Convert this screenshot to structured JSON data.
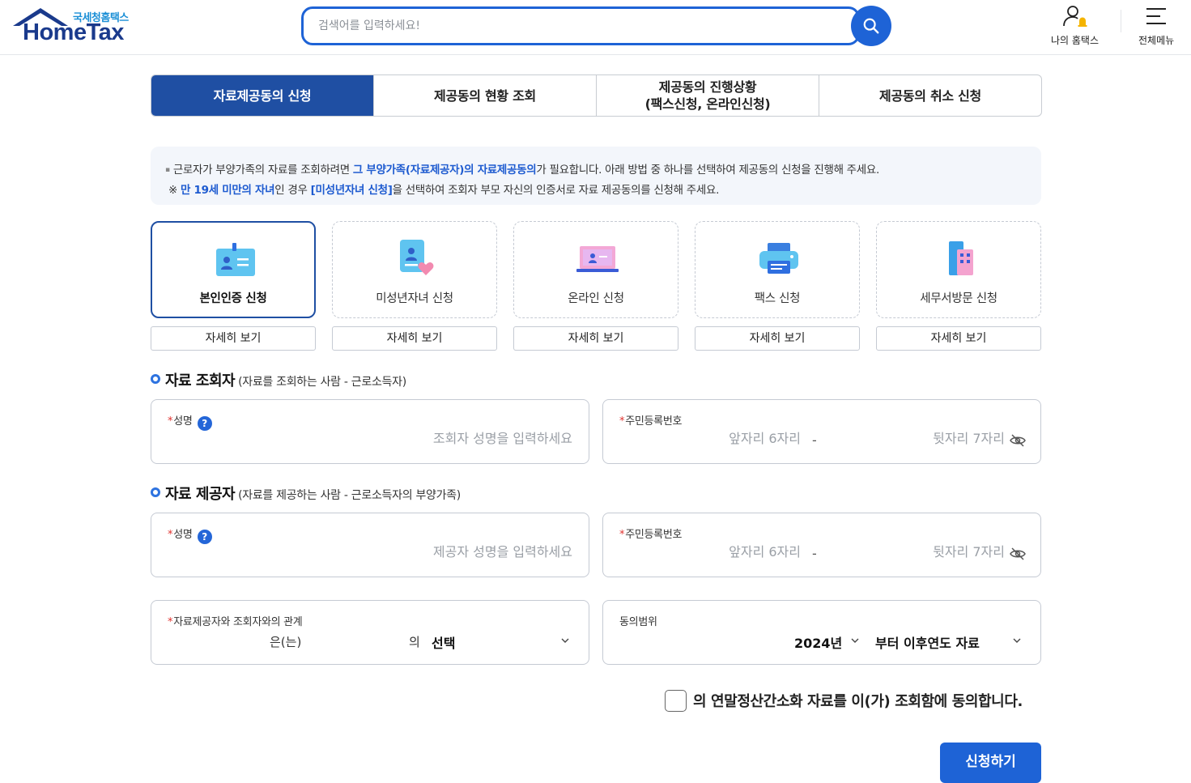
{
  "header": {
    "logo_sub": "국세청홈택스",
    "logo_main": "HomeTax",
    "search_placeholder": "검색어를 입력하세요!",
    "my_hometax": "나의 홈택스",
    "all_menu": "전체메뉴"
  },
  "tabs": [
    {
      "label": "자료제공동의 신청",
      "active": true
    },
    {
      "label": "제공동의 현황 조회",
      "active": false
    },
    {
      "label_line1": "제공동의 진행상황",
      "label_line2": "(팩스신청, 온라인신청)",
      "active": false
    },
    {
      "label": "제공동의 취소 신청",
      "active": false
    }
  ],
  "notice": {
    "l1_a": "근로자가 부양가족의 자료를 조회하려면 ",
    "l1_b": "그 부양가족(자료제공자)의 자료제공동의",
    "l1_c": "가 필요합니다. 아래 방법 중 하나를 선택하여 제공동의 신청을 진행해 주세요.",
    "l2_a": "※ ",
    "l2_b": "만 19세 미만의 자녀",
    "l2_c": "인 경우 ",
    "l2_d": "[미성년자녀 신청]",
    "l2_e": "을 선택하여 조회자 부모 자신의 인증서로 자료 제공동의를 신청해 주세요."
  },
  "methods": [
    {
      "label": "본인인증 신청",
      "icon": "id-card-icon",
      "detail": "자세히 보기",
      "selected": true
    },
    {
      "label": "미성년자녀 신청",
      "icon": "child-heart-icon",
      "detail": "자세히 보기",
      "selected": false
    },
    {
      "label": "온라인 신청",
      "icon": "laptop-icon",
      "detail": "자세히 보기",
      "selected": false
    },
    {
      "label": "팩스 신청",
      "icon": "fax-icon",
      "detail": "자세히 보기",
      "selected": false
    },
    {
      "label": "세무서방문 신청",
      "icon": "building-icon",
      "detail": "자세히 보기",
      "selected": false
    }
  ],
  "viewer": {
    "title": "자료 조회자",
    "subtitle": "(자료를 조회하는 사람 - 근로소득자)",
    "name_label": "성명",
    "name_placeholder": "조회자 성명을 입력하세요",
    "rrn_label": "주민등록번호",
    "rrn_front_placeholder": "앞자리 6자리",
    "rrn_back_placeholder": "뒷자리 7자리",
    "dash": "-"
  },
  "provider": {
    "title": "자료 제공자",
    "subtitle": "(자료를 제공하는 사람 - 근로소득자의 부양가족)",
    "name_label": "성명",
    "name_placeholder": "제공자 성명을 입력하세요",
    "rrn_label": "주민등록번호",
    "rrn_front_placeholder": "앞자리 6자리",
    "rrn_back_placeholder": "뒷자리 7자리",
    "dash": "-"
  },
  "relation": {
    "label": "자료제공자와 조회자와의 관계",
    "eun": "은(는)",
    "ui": "의",
    "select": "선택"
  },
  "scope": {
    "label": "동의범위",
    "year": "2024년",
    "range": "부터 이후연도 자료"
  },
  "required_mark": "*",
  "help_mark": "?",
  "agree_text": "의 연말정산간소화 자료를 이(가) 조회함에 동의합니다.",
  "submit": "신청하기",
  "colors": {
    "primary": "#1e63d6",
    "tab_active": "#1f4fa3",
    "required": "#e0322f"
  }
}
